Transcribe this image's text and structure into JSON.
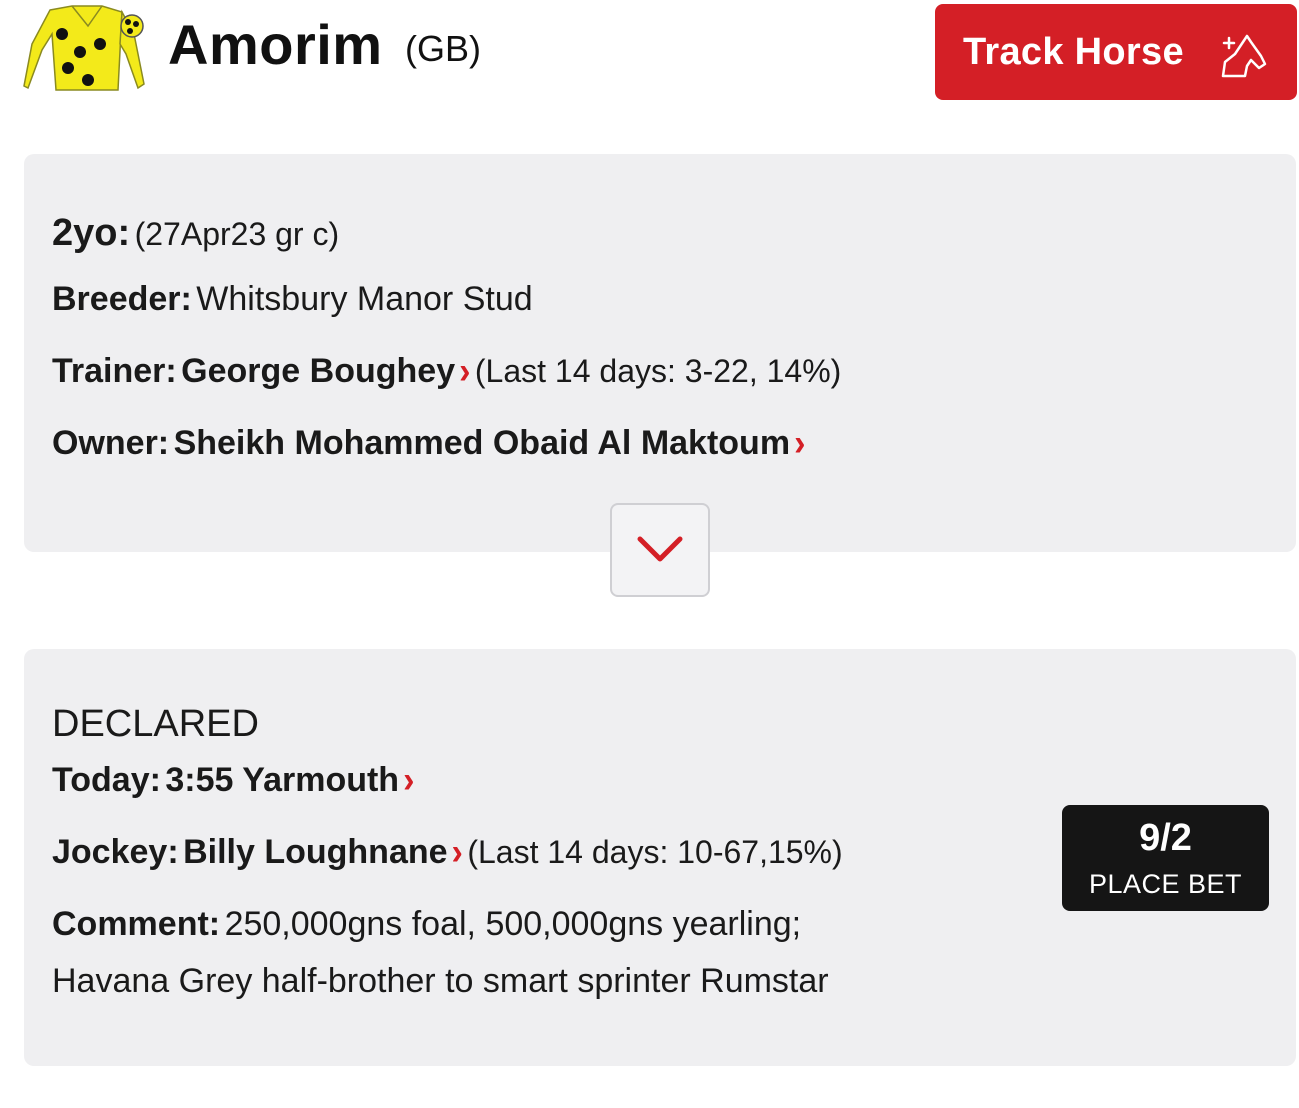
{
  "horse": {
    "name": "Amorim",
    "country": "(GB)",
    "track_button_label": "Track Horse"
  },
  "details": {
    "age_label": "2yo:",
    "age_value": "(27Apr23 gr c)",
    "breeder_label": "Breeder:",
    "breeder_value": "Whitsbury Manor Stud",
    "trainer_label": "Trainer:",
    "trainer_name": "George Boughey",
    "trainer_stats": "(Last 14 days: 3-22, 14%)",
    "owner_label": "Owner:",
    "owner_name": "Sheikh Mohammed Obaid Al Maktoum"
  },
  "entry": {
    "status": "DECLARED",
    "today_label": "Today:",
    "today_race": "3:55 Yarmouth",
    "jockey_label": "Jockey:",
    "jockey_name": "Billy Loughnane",
    "jockey_stats": "(Last 14 days: 10-67,15%)",
    "comment_label": "Comment:",
    "comment_line1": "250,000gns foal, 500,000gns yearling;",
    "comment_line2": "Havana Grey half-brother to smart sprinter Rumstar",
    "bet_odds": "9/2",
    "bet_label": "PLACE BET"
  },
  "icons": {
    "silks": "jockey-silks-icon",
    "track": "horse-plus-icon",
    "expand": "chevron-down-icon",
    "link_chevron": "chevron-right-icon"
  },
  "colors": {
    "accent_red": "#d41f26",
    "card_bg": "#efeff1",
    "bet_button_bg": "#151515",
    "silks_yellow": "#f3ea1a"
  }
}
